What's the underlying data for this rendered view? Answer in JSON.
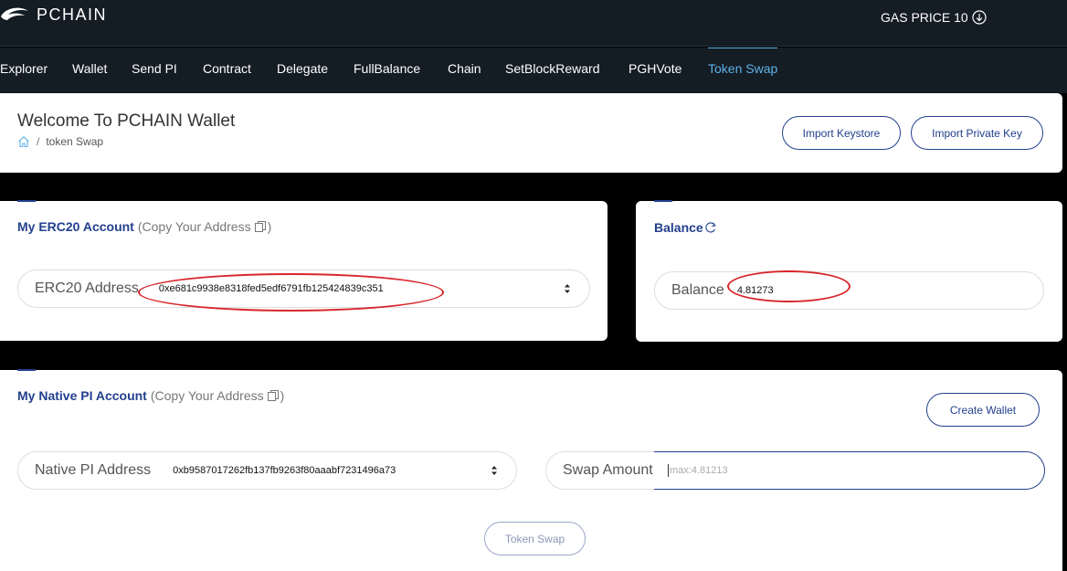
{
  "brand": {
    "name": "PCHAIN"
  },
  "gas": {
    "label": "GAS PRICE 10"
  },
  "nav": {
    "items": [
      {
        "label": "Explorer"
      },
      {
        "label": "Wallet"
      },
      {
        "label": "Send PI"
      },
      {
        "label": "Contract"
      },
      {
        "label": "Delegate"
      },
      {
        "label": "FullBalance"
      },
      {
        "label": "Chain"
      },
      {
        "label": "SetBlockReward"
      },
      {
        "label": "PGHVote"
      },
      {
        "label": "Token Swap",
        "active": true
      }
    ]
  },
  "header": {
    "title": "Welcome To PCHAIN Wallet",
    "breadcrumb": {
      "separator": "/",
      "current": "token Swap"
    },
    "import_keystore_label": "Import Keystore",
    "import_private_key_label": "Import Private Key"
  },
  "erc20": {
    "title": "My ERC20 Account",
    "copy_hint": "(Copy Your Address",
    "copy_hint_close": ")",
    "address_label": "ERC20 Address",
    "address_value": "0xe681c9938e8318fed5edf6791fb125424839c351"
  },
  "balance": {
    "title": "Balance",
    "label": "Balance",
    "value": "4.81273"
  },
  "native": {
    "title": "My Native PI Account",
    "copy_hint": "(Copy Your Address",
    "copy_hint_close": ")",
    "create_wallet_label": "Create Wallet",
    "address_label": "Native PI Address",
    "address_value": "0xb9587017262fb137fb9263f80aaabf7231496a73",
    "swap_amount_label": "Swap Amount",
    "swap_amount_placeholder": "max:4.81213",
    "token_swap_label": "Token Swap"
  },
  "colors": {
    "nav_bg": "#141c24",
    "accent": "#23408e",
    "active_tab": "#5fb3e8",
    "highlight_ring": "#d8262b"
  }
}
